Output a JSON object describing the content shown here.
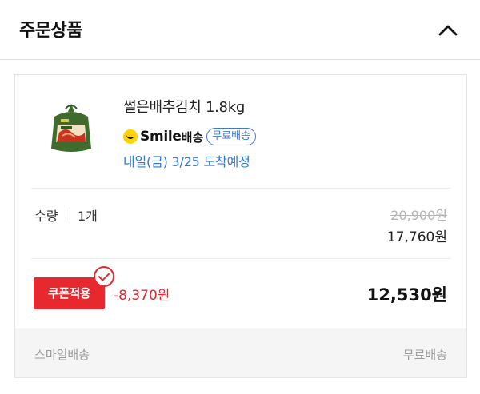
{
  "header": {
    "title": "주문상품"
  },
  "product": {
    "name": "썰은배추김치 1.8kg",
    "image_icon": "kimchi-package-icon",
    "smile_brand": "Smile",
    "smile_suffix": "배송",
    "free_badge": "무료배송",
    "delivery_date": "내일(금) 3/25 도착예정"
  },
  "quantity": {
    "label": "수량",
    "value": "1개"
  },
  "price": {
    "original": "20,900원",
    "sale": "17,760원"
  },
  "coupon": {
    "label": "쿠폰적용",
    "discount": "-8,370원",
    "final": "12,530원"
  },
  "shipping": {
    "method": "스마일배송",
    "fee": "무료배송"
  },
  "colors": {
    "accent_red": "#e8282f",
    "accent_blue": "#2f7ad6",
    "smile_yellow": "#ffd400"
  }
}
